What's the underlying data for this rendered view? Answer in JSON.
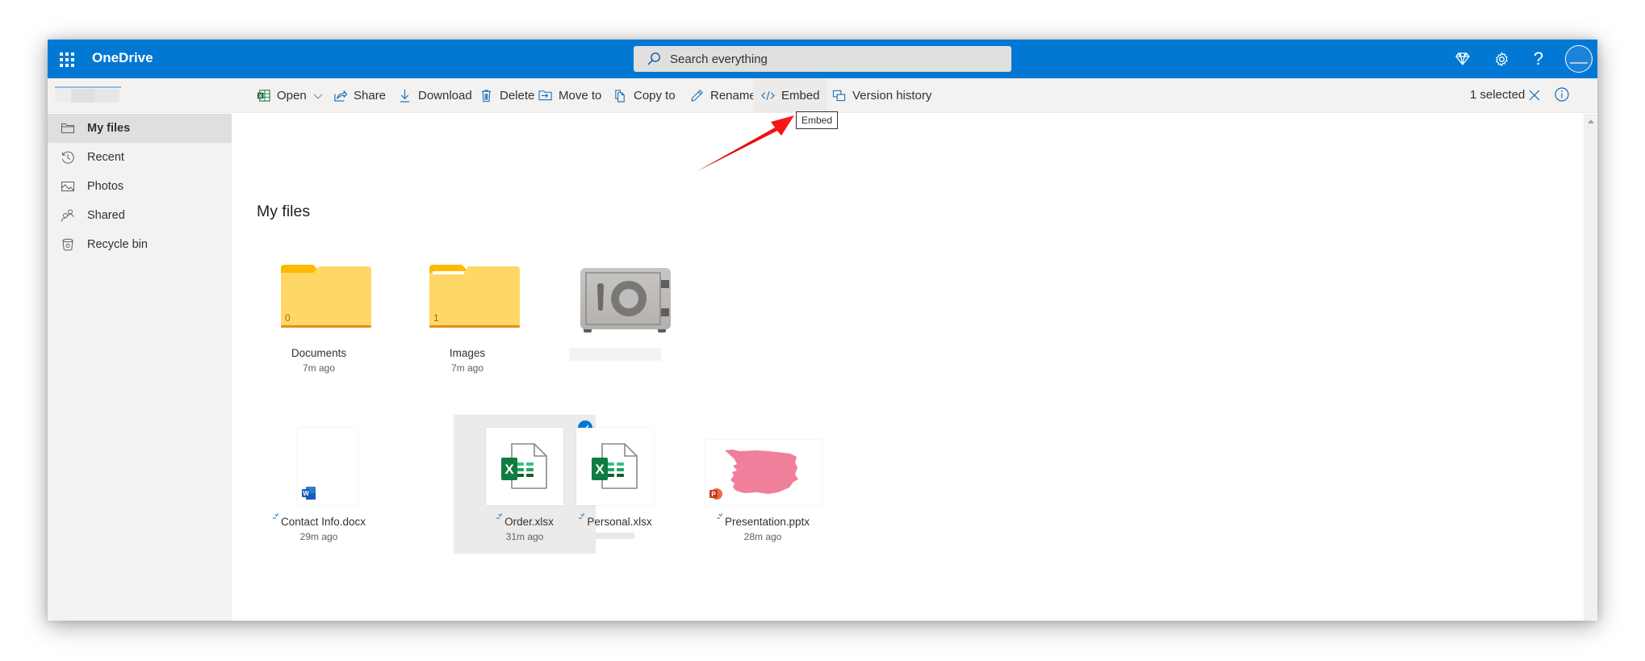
{
  "app": {
    "title": "OneDrive",
    "search_placeholder": "Search everything"
  },
  "suite_icons": [
    {
      "name": "premium-diamond-icon",
      "label": "Premium"
    },
    {
      "name": "settings-gear-icon",
      "label": "Settings"
    },
    {
      "name": "help-icon",
      "label": "Help"
    }
  ],
  "toolbar": {
    "commands": [
      {
        "id": "open",
        "label": "Open",
        "icon": "excel-icon",
        "has_dropdown": true
      },
      {
        "id": "share",
        "label": "Share",
        "icon": "share-icon"
      },
      {
        "id": "download",
        "label": "Download",
        "icon": "download-icon"
      },
      {
        "id": "delete",
        "label": "Delete",
        "icon": "trash-icon"
      },
      {
        "id": "move",
        "label": "Move to",
        "icon": "move-to-icon"
      },
      {
        "id": "copy",
        "label": "Copy to",
        "icon": "copy-icon"
      },
      {
        "id": "rename",
        "label": "Rename",
        "icon": "pencil-icon"
      },
      {
        "id": "embed",
        "label": "Embed",
        "icon": "code-icon",
        "hovered": true
      },
      {
        "id": "version",
        "label": "Version history",
        "icon": "version-history-icon"
      }
    ],
    "selection_count": "1 selected",
    "tooltip": "Embed"
  },
  "sidebar": {
    "items": [
      {
        "label": "My files",
        "icon": "folder-icon",
        "active": true
      },
      {
        "label": "Recent",
        "icon": "history-icon"
      },
      {
        "label": "Photos",
        "icon": "photo-icon"
      },
      {
        "label": "Shared",
        "icon": "people-icon"
      },
      {
        "label": "Recycle bin",
        "icon": "recycle-bin-icon"
      }
    ]
  },
  "main": {
    "title": "My files",
    "folders": [
      {
        "name": "Documents",
        "modified": "7m ago",
        "item_count": "0"
      },
      {
        "name": "Images",
        "modified": "7m ago",
        "item_count": "1"
      },
      {
        "name": "",
        "modified": "",
        "type": "personal-vault"
      }
    ],
    "files": [
      {
        "name": "Contact Info.docx",
        "modified": "29m ago",
        "type": "word",
        "selected": false
      },
      {
        "name": "Order.xlsx",
        "modified": "31m ago",
        "type": "excel",
        "selected": true
      },
      {
        "name": "Personal.xlsx",
        "modified": "",
        "type": "excel",
        "selected": false
      },
      {
        "name": "Presentation.pptx",
        "modified": "28m ago",
        "type": "powerpoint",
        "selected": false
      }
    ]
  },
  "colors": {
    "brand_blue": "#0078d4",
    "command_bar": "#f3f2f1",
    "folder_yellow": "#ffd766",
    "annotation_red": "#e00000"
  }
}
